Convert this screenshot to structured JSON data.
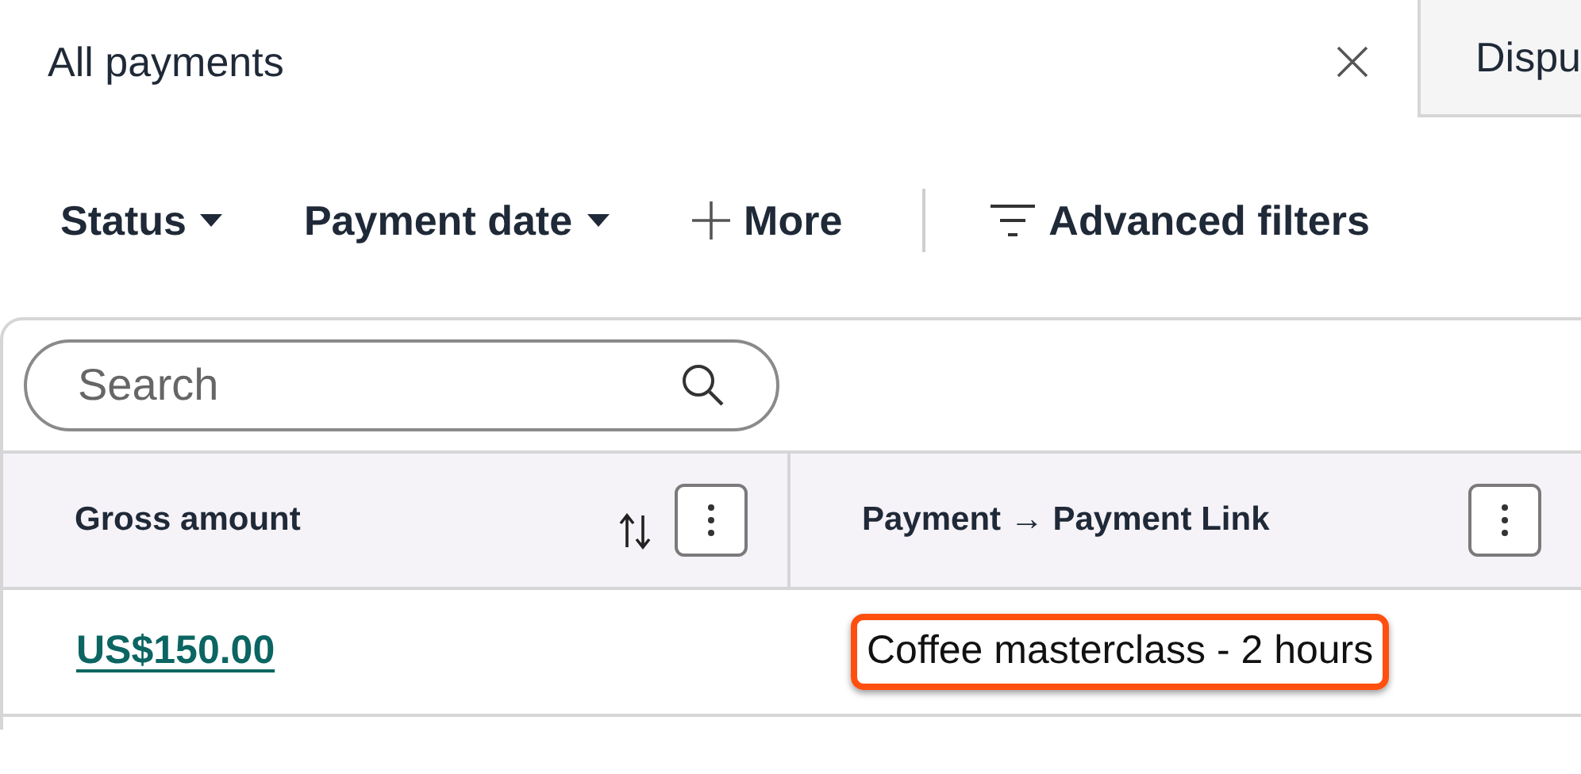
{
  "tabs": [
    {
      "label": "All payments",
      "selected": true,
      "closable": true
    },
    {
      "label": "Dispu",
      "selected": false,
      "closable": false
    }
  ],
  "filters": [
    {
      "label": "Status",
      "kind": "dropdown"
    },
    {
      "label": "Payment date",
      "kind": "dropdown"
    },
    {
      "label": "More",
      "kind": "add"
    },
    {
      "label": "Advanced filters",
      "kind": "advanced"
    }
  ],
  "search": {
    "placeholder": "Search"
  },
  "table": {
    "columns": [
      {
        "label": "Gross amount",
        "sortable": true
      },
      {
        "label": "Payment → Payment Link",
        "sortable": false
      }
    ],
    "rows": [
      [
        {
          "text": "US$150.00",
          "kind": "link",
          "highlighted": false
        },
        {
          "text": "Coffee masterclass - 2 hours",
          "kind": "text",
          "highlighted": true
        }
      ]
    ]
  }
}
